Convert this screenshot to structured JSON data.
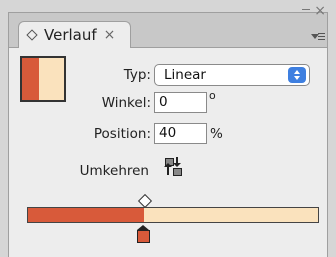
{
  "panel": {
    "tab_label": "Verlauf",
    "tab_close": "×",
    "window_close": "×"
  },
  "gradient": {
    "type_label": "Typ:",
    "type_value": "Linear",
    "angle_label": "Winkel:",
    "angle_value": "0",
    "angle_unit": "o",
    "position_label": "Position:",
    "position_value": "40",
    "position_unit": "%",
    "reverse_label": "Umkehren",
    "stop_position_percent": 40,
    "colors": {
      "start": "#d85a3a",
      "end": "#fae2bd"
    }
  }
}
